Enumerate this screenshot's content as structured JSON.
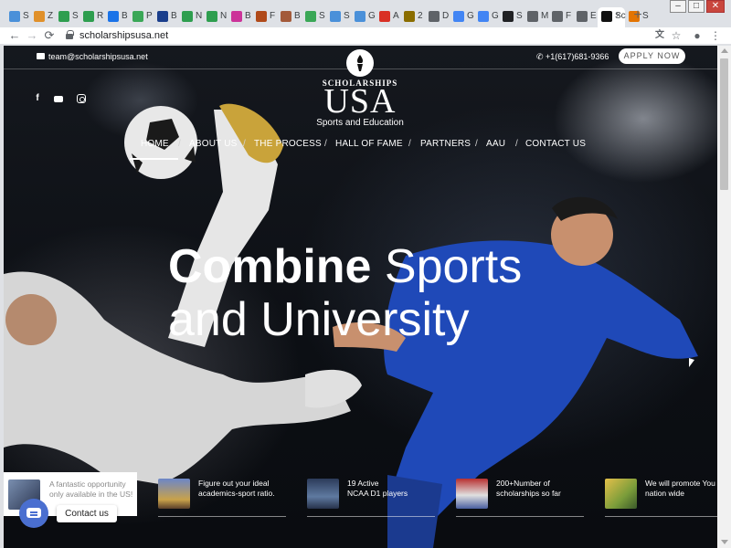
{
  "browser": {
    "tabs": [
      {
        "title": "S",
        "color": "#4a90d9"
      },
      {
        "title": "Z",
        "color": "#e0902a"
      },
      {
        "title": "S",
        "color": "#2e9e4f"
      },
      {
        "title": "R",
        "color": "#2e9e4f"
      },
      {
        "title": "B",
        "color": "#1a73e8"
      },
      {
        "title": "P",
        "color": "#3aa757"
      },
      {
        "title": "B",
        "color": "#1a3e8c"
      },
      {
        "title": "N",
        "color": "#2e9e4f"
      },
      {
        "title": "N",
        "color": "#2e9e4f"
      },
      {
        "title": "B",
        "color": "#cc3399"
      },
      {
        "title": "F",
        "color": "#b04a1a"
      },
      {
        "title": "B",
        "color": "#a35a3a"
      },
      {
        "title": "S",
        "color": "#3aa757"
      },
      {
        "title": "S",
        "color": "#4a90d9"
      },
      {
        "title": "G",
        "color": "#4a90d9"
      },
      {
        "title": "A",
        "color": "#d93025"
      },
      {
        "title": "2",
        "color": "#8a6d00"
      },
      {
        "title": "D",
        "color": "#5f6368"
      },
      {
        "title": "G",
        "color": "#4285f4"
      },
      {
        "title": "G",
        "color": "#4285f4"
      },
      {
        "title": "S",
        "color": "#202124"
      },
      {
        "title": "M",
        "color": "#5f6368"
      },
      {
        "title": "F",
        "color": "#5f6368"
      },
      {
        "title": "E",
        "color": "#5f6368"
      },
      {
        "title": "Sc",
        "color": "#111111",
        "active": true
      },
      {
        "title": "S",
        "color": "#e37400"
      }
    ],
    "new_tab": "+",
    "window_controls": {
      "minimize": "–",
      "maximize": "□",
      "close": "✕"
    },
    "url": "scholarshipsusa.net"
  },
  "site": {
    "email": "team@scholarshipsusa.net",
    "phone": "+1(617)681-9366",
    "apply_label": "APPLY NOW",
    "logo": {
      "top": "SCHOLARSHIPS",
      "main": "USA",
      "sub": "Sports and Education"
    },
    "social": [
      "facebook-icon",
      "youtube-icon",
      "instagram-icon"
    ],
    "nav": [
      "HOME",
      "ABOUT US",
      "THE PROCESS",
      "HALL OF FAME",
      "PARTNERS",
      "AAU",
      "CONTACT US"
    ],
    "nav_separator": "/",
    "headline": {
      "bold": "Combine",
      "rest1": " Sports",
      "line2": "and University"
    },
    "features": [
      {
        "line1": "A fantastic opportunity",
        "line2": "only available in the US!"
      },
      {
        "line1": "Figure out your ideal",
        "line2": "academics-sport ratio."
      },
      {
        "line1": "19 Active",
        "line2": "NCAA D1 players"
      },
      {
        "line1": "200+Number of",
        "line2": "scholarships so far"
      },
      {
        "line1": "We will promote You",
        "line2": "nation wide"
      }
    ],
    "chat_label": "Contact us"
  }
}
